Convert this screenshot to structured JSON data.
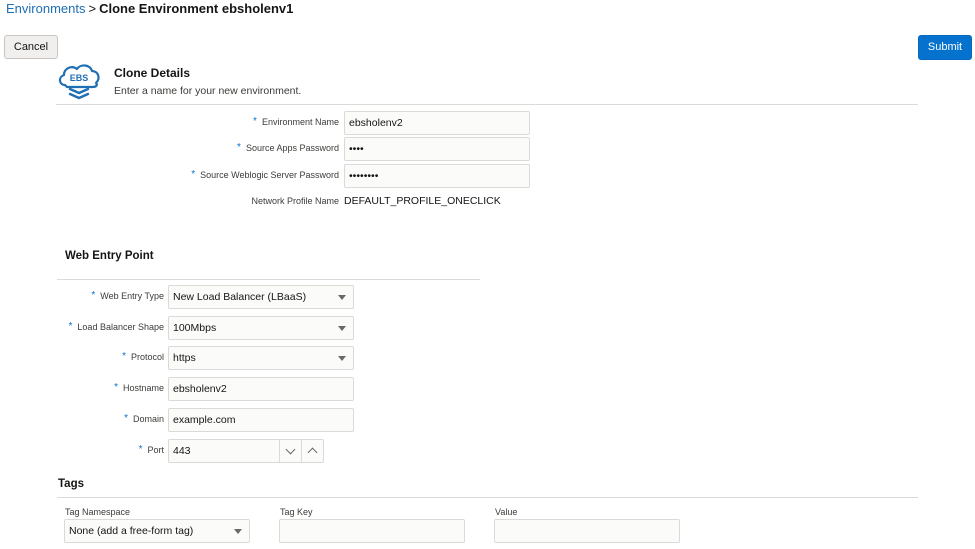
{
  "breadcrumb": {
    "link": "Environments",
    "separator": ">",
    "current": "Clone Environment ebsholenv1"
  },
  "buttons": {
    "cancel": "Cancel",
    "submit": "Submit"
  },
  "clone_details": {
    "logo_text": "EBS",
    "title": "Clone Details",
    "subtitle": "Enter a name for your new environment.",
    "fields": {
      "env_name": {
        "label": "Environment Name",
        "value": "ebsholenv2"
      },
      "apps_password": {
        "label": "Source Apps Password",
        "value": "••••"
      },
      "weblogic_password": {
        "label": "Source Weblogic Server Password",
        "value": "••••••••"
      },
      "network_profile": {
        "label": "Network Profile Name",
        "value": "DEFAULT_PROFILE_ONECLICK"
      }
    }
  },
  "web_entry": {
    "title": "Web Entry Point",
    "fields": {
      "entry_type": {
        "label": "Web Entry Type",
        "value": "New Load Balancer (LBaaS)"
      },
      "lb_shape": {
        "label": "Load Balancer Shape",
        "value": "100Mbps"
      },
      "protocol": {
        "label": "Protocol",
        "value": "https"
      },
      "hostname": {
        "label": "Hostname",
        "value": "ebsholenv2"
      },
      "domain": {
        "label": "Domain",
        "value": "example.com"
      },
      "port": {
        "label": "Port",
        "value": "443"
      }
    }
  },
  "tags": {
    "title": "Tags",
    "namespace_label": "Tag Namespace",
    "namespace_value": "None (add a free-form tag)",
    "key_label": "Tag Key",
    "key_value": "",
    "value_label": "Value",
    "value_value": ""
  },
  "colors": {
    "accent": "#0572ce",
    "link": "#1f6fb5",
    "required_marker": "#0572ce"
  },
  "icons": [
    "ebs-cloud-logo",
    "chevron-down-icon",
    "chevron-up-icon",
    "select-arrow-icon"
  ]
}
